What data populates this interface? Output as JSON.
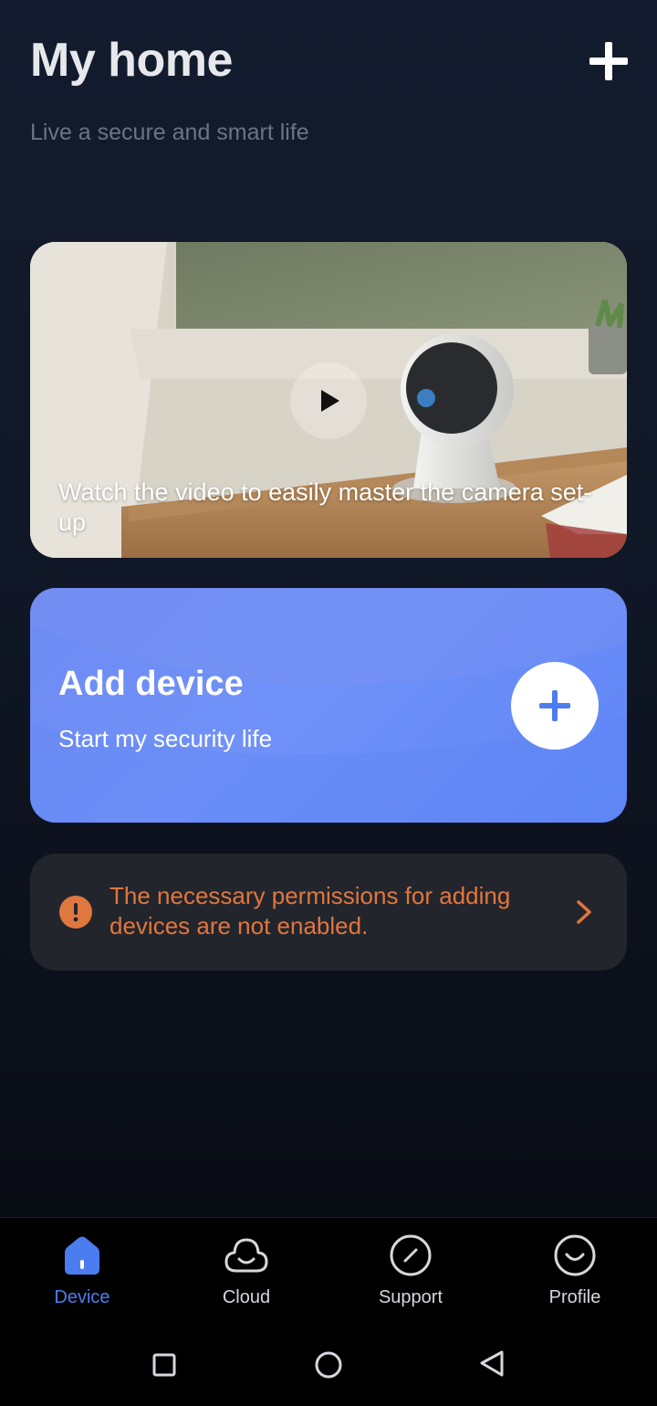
{
  "header": {
    "title": "My home",
    "subtitle": "Live a secure and smart life",
    "add_icon": "plus-icon"
  },
  "video_card": {
    "caption": "Watch the video to easily master the camera set-up",
    "play_icon": "play-icon"
  },
  "add_device_card": {
    "title": "Add device",
    "subtitle": "Start my security life",
    "button_icon": "plus-icon"
  },
  "permission_banner": {
    "text": "The necessary permissions for adding devices are not enabled.",
    "icon": "warning-icon",
    "chevron": "chevron-right-icon"
  },
  "bottom_nav": {
    "items": [
      {
        "label": "Device",
        "icon": "home-icon",
        "active": true
      },
      {
        "label": "Cloud",
        "icon": "cloud-icon",
        "active": false
      },
      {
        "label": "Support",
        "icon": "support-icon",
        "active": false
      },
      {
        "label": "Profile",
        "icon": "profile-icon",
        "active": false
      }
    ]
  },
  "system_nav": [
    "recents-button",
    "home-button",
    "back-button"
  ],
  "colors": {
    "accent": "#4c7df0",
    "warning": "#e0773f",
    "card_blue": "#6f8bf3",
    "background": "#101726"
  }
}
